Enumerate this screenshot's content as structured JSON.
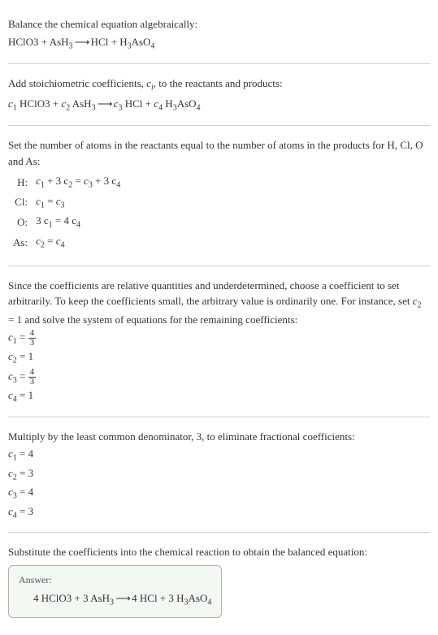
{
  "intro": {
    "line1": "Balance the chemical equation algebraically:",
    "eq_lhs1": "HClO3",
    "plus": " + ",
    "eq_lhs2": "AsH",
    "eq_lhs2_sub": "3",
    "arrow": " ⟶ ",
    "eq_rhs1": "HCl",
    "eq_rhs2": "H",
    "eq_rhs2_sub1": "3",
    "eq_rhs2_mid": "AsO",
    "eq_rhs2_sub2": "4"
  },
  "stoich": {
    "text_a": "Add stoichiometric coefficients, ",
    "ci": "c",
    "ci_sub": "i",
    "text_b": ", to the reactants and products:",
    "c1": "c",
    "c1s": "1",
    "sp1": " HClO3 + ",
    "c2": "c",
    "c2s": "2",
    "sp2": " AsH",
    "sp2sub": "3",
    "arrow": " ⟶ ",
    "c3": "c",
    "c3s": "3",
    "sp3": " HCl + ",
    "c4": "c",
    "c4s": "4",
    "sp4a": " H",
    "sp4sub1": "3",
    "sp4b": "AsO",
    "sp4sub2": "4"
  },
  "atoms": {
    "intro": "Set the number of atoms in the reactants equal to the number of atoms in the products for H, Cl, O and As:",
    "rows": [
      {
        "el": "H:",
        "lhs_a": "c",
        "lhs_as": "1",
        "lhs_b": " + 3 c",
        "lhs_bs": "2",
        "eq": " = ",
        "rhs_a": "c",
        "rhs_as": "3",
        "rhs_b": " + 3 c",
        "rhs_bs": "4"
      },
      {
        "el": "Cl:",
        "lhs_a": "c",
        "lhs_as": "1",
        "lhs_b": "",
        "lhs_bs": "",
        "eq": " = ",
        "rhs_a": "c",
        "rhs_as": "3",
        "rhs_b": "",
        "rhs_bs": ""
      },
      {
        "el": "O:",
        "lhs_a": "3 c",
        "lhs_as": "1",
        "lhs_b": "",
        "lhs_bs": "",
        "eq": " = ",
        "rhs_a": "4 c",
        "rhs_as": "4",
        "rhs_b": "",
        "rhs_bs": ""
      },
      {
        "el": "As:",
        "lhs_a": "c",
        "lhs_as": "2",
        "lhs_b": "",
        "lhs_bs": "",
        "eq": " = ",
        "rhs_a": "c",
        "rhs_as": "4",
        "rhs_b": "",
        "rhs_bs": ""
      }
    ]
  },
  "solve": {
    "text_a": "Since the coefficients are relative quantities and underdetermined, choose a coefficient to set arbitrarily. To keep the coefficients small, the arbitrary value is ordinarily one. For instance, set ",
    "cvar": "c",
    "cvar_s": "2",
    "text_b": " = 1 and solve the system of equations for the remaining coefficients:",
    "c1l": "c",
    "c1s": "1",
    "c1eq": " = ",
    "c1num": "4",
    "c1den": "3",
    "c2l": "c",
    "c2s": "2",
    "c2eq": " = 1",
    "c3l": "c",
    "c3s": "3",
    "c3eq": " = ",
    "c3num": "4",
    "c3den": "3",
    "c4l": "c",
    "c4s": "4",
    "c4eq": " = 1"
  },
  "mult": {
    "text": "Multiply by the least common denominator, 3, to eliminate fractional coefficients:",
    "lines": [
      {
        "c": "c",
        "s": "1",
        "v": " = 4"
      },
      {
        "c": "c",
        "s": "2",
        "v": " = 3"
      },
      {
        "c": "c",
        "s": "3",
        "v": " = 4"
      },
      {
        "c": "c",
        "s": "4",
        "v": " = 3"
      }
    ]
  },
  "final": {
    "text": "Substitute the coefficients into the chemical reaction to obtain the balanced equation:",
    "answer_label": "Answer:",
    "eq_a": "4 HClO3 + 3 AsH",
    "eq_a_sub": "3",
    "arrow": " ⟶ ",
    "eq_b": "4 HCl + 3 H",
    "eq_b_sub1": "3",
    "eq_c": "AsO",
    "eq_c_sub": "4"
  }
}
